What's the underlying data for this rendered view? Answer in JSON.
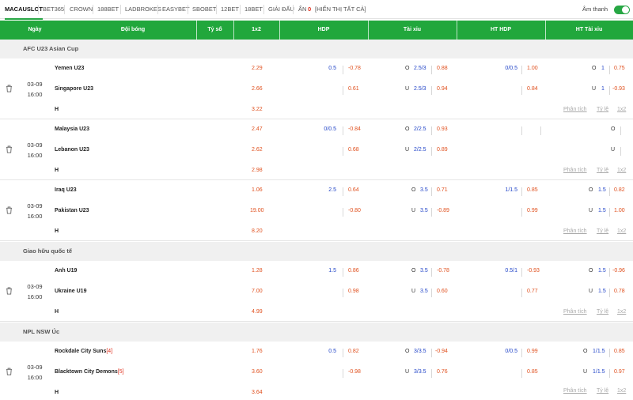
{
  "tabs": [
    "MACAUSLOT",
    "BET365",
    "CROWN",
    "188BET",
    "LADBROKES",
    "EASYBET",
    "SBOBET",
    "12BET",
    "18BET",
    "GIẢI ĐẤU"
  ],
  "toolbar": {
    "hidden_label": "ẨN",
    "hidden_count": "0",
    "show_all": "[HIỂN THỊ TẤT CẢ]",
    "sound_label": "Âm thanh",
    "sound_on": true
  },
  "header": {
    "date": "Ngày",
    "teams": "Đội bóng",
    "score": "Tỷ số",
    "x12": "1x2",
    "hdp": "HDP",
    "taixiu": "Tài xỉu",
    "ht_hdp": "HT HDP",
    "ht_taixiu": "HT Tài xỉu"
  },
  "links": {
    "analysis": "Phân tích",
    "rate": "Tỷ lệ",
    "x12": "1x2"
  },
  "colors": {
    "accent": "#21a73c",
    "odds_red": "#e0501e",
    "odds_blue": "#2245c8"
  },
  "leagues": [
    {
      "name": "AFC U23 Asian Cup",
      "matches": [
        {
          "date": "03-09",
          "time": "16:00",
          "home": "Yemen U23",
          "home_rank": "",
          "away": "Singapore U23",
          "away_rank": "",
          "draw_label": "H",
          "x12": [
            "2.29",
            "2.66",
            "3.22"
          ],
          "hdp": {
            "home_line": "0.5",
            "home": "-0.78",
            "away_line": "",
            "away": "0.61"
          },
          "ou": {
            "over_tag": "O",
            "over_line": "2.5/3",
            "over": "0.88",
            "under_tag": "U",
            "under_line": "2.5/3",
            "under": "0.94"
          },
          "ht_hdp": {
            "home_line": "0/0.5",
            "home": "1.00",
            "away_line": "",
            "away": "0.84"
          },
          "ht_ou": {
            "over_tag": "O",
            "over_line": "1",
            "over": "0.75",
            "under_tag": "U",
            "under_line": "1",
            "under": "-0.93"
          }
        },
        {
          "date": "03-09",
          "time": "16:00",
          "home": "Malaysia U23",
          "home_rank": "",
          "away": "Lebanon U23",
          "away_rank": "",
          "draw_label": "H",
          "x12": [
            "2.47",
            "2.62",
            "2.98"
          ],
          "hdp": {
            "home_line": "0/0.5",
            "home": "-0.84",
            "away_line": "",
            "away": "0.68"
          },
          "ou": {
            "over_tag": "O",
            "over_line": "2/2.5",
            "over": "0.93",
            "under_tag": "U",
            "under_line": "2/2.5",
            "under": "0.89"
          },
          "ht_hdp": {
            "home_line": "",
            "home": "",
            "away_line": "",
            "away": ""
          },
          "ht_ou": {
            "over_tag": "O",
            "over_line": "",
            "over": "",
            "under_tag": "U",
            "under_line": "",
            "under": ""
          }
        },
        {
          "date": "03-09",
          "time": "16:00",
          "home": "Iraq U23",
          "home_rank": "",
          "away": "Pakistan U23",
          "away_rank": "",
          "draw_label": "H",
          "x12": [
            "1.06",
            "19.00",
            "8.20"
          ],
          "hdp": {
            "home_line": "2.5",
            "home": "0.64",
            "away_line": "",
            "away": "-0.80"
          },
          "ou": {
            "over_tag": "O",
            "over_line": "3.5",
            "over": "0.71",
            "under_tag": "U",
            "under_line": "3.5",
            "under": "-0.89"
          },
          "ht_hdp": {
            "home_line": "1/1.5",
            "home": "0.85",
            "away_line": "",
            "away": "0.99"
          },
          "ht_ou": {
            "over_tag": "O",
            "over_line": "1.5",
            "over": "0.82",
            "under_tag": "U",
            "under_line": "1.5",
            "under": "1.00"
          }
        }
      ]
    },
    {
      "name": "Giao hữu quốc tế",
      "matches": [
        {
          "date": "03-09",
          "time": "16:00",
          "home": "Anh U19",
          "home_rank": "",
          "away": "Ukraine U19",
          "away_rank": "",
          "draw_label": "H",
          "x12": [
            "1.28",
            "7.00",
            "4.99"
          ],
          "hdp": {
            "home_line": "1.5",
            "home": "0.86",
            "away_line": "",
            "away": "0.98"
          },
          "ou": {
            "over_tag": "O",
            "over_line": "3.5",
            "over": "-0.78",
            "under_tag": "U",
            "under_line": "3.5",
            "under": "0.60"
          },
          "ht_hdp": {
            "home_line": "0.5/1",
            "home": "-0.93",
            "away_line": "",
            "away": "0.77"
          },
          "ht_ou": {
            "over_tag": "O",
            "over_line": "1.5",
            "over": "-0.96",
            "under_tag": "U",
            "under_line": "1.5",
            "under": "0.78"
          }
        }
      ]
    },
    {
      "name": "NPL NSW Úc",
      "matches": [
        {
          "date": "03-09",
          "time": "16:00",
          "home": "Rockdale City Suns",
          "home_rank": "[4]",
          "away": "Blacktown City Demons",
          "away_rank": "[5]",
          "draw_label": "H",
          "x12": [
            "1.76",
            "3.60",
            "3.64"
          ],
          "hdp": {
            "home_line": "0.5",
            "home": "0.82",
            "away_line": "",
            "away": "-0.98"
          },
          "ou": {
            "over_tag": "O",
            "over_line": "3/3.5",
            "over": "-0.94",
            "under_tag": "U",
            "under_line": "3/3.5",
            "under": "0.76"
          },
          "ht_hdp": {
            "home_line": "0/0.5",
            "home": "0.99",
            "away_line": "",
            "away": "0.85"
          },
          "ht_ou": {
            "over_tag": "O",
            "over_line": "1/1.5",
            "over": "0.85",
            "under_tag": "U",
            "under_line": "1/1.5",
            "under": "0.97"
          }
        }
      ]
    }
  ]
}
